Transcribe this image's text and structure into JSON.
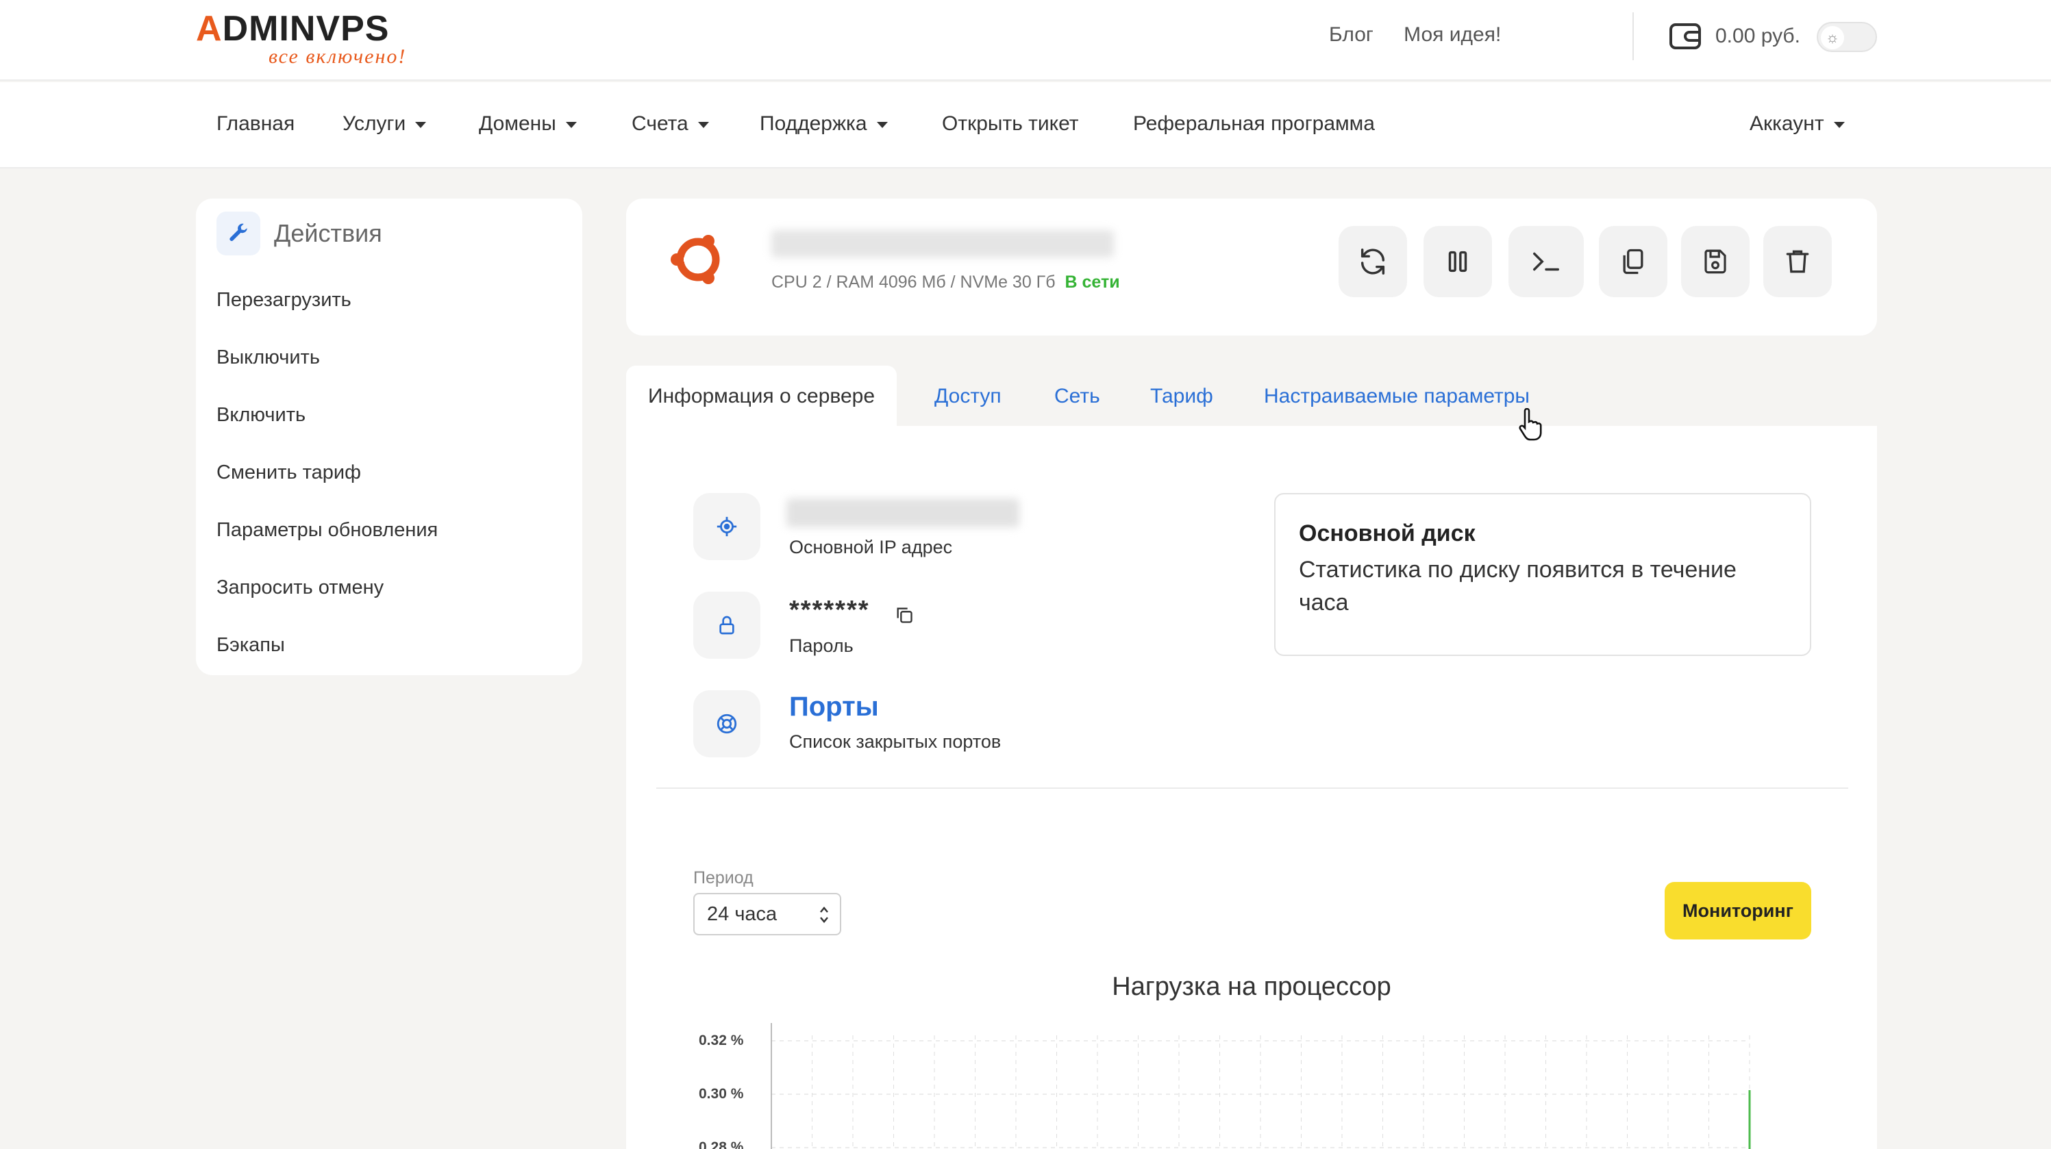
{
  "header": {
    "logo_brand_a": "A",
    "logo_brand_rest": "DMINVPS",
    "logo_slogan": "все включено!",
    "links": [
      "Блог",
      "Моя идея!"
    ],
    "balance": "0.00 руб.",
    "wallet_icon": "wallet-icon",
    "theme_icon": "sun-icon"
  },
  "nav": {
    "items": [
      {
        "label": "Главная",
        "dropdown": false
      },
      {
        "label": "Услуги",
        "dropdown": true
      },
      {
        "label": "Домены",
        "dropdown": true
      },
      {
        "label": "Счета",
        "dropdown": true
      },
      {
        "label": "Поддержка",
        "dropdown": true
      },
      {
        "label": "Открыть тикет",
        "dropdown": false
      },
      {
        "label": "Реферальная программа",
        "dropdown": false
      }
    ],
    "account": "Аккаунт"
  },
  "sidebar": {
    "title": "Действия",
    "icon": "wrench-icon",
    "items": [
      {
        "label": "Перезагрузить"
      },
      {
        "label": "Выключить"
      },
      {
        "label": "Включить"
      },
      {
        "label": "Сменить тариф"
      },
      {
        "label": "Параметры обновления"
      },
      {
        "label": "Запросить отмену"
      },
      {
        "label": "Бэкапы"
      }
    ]
  },
  "server": {
    "os_icon": "ubuntu-icon",
    "specs": "CPU 2 / RAM 4096 Мб / NVMe 30 Гб",
    "status": "В сети",
    "status_color": "#35b335",
    "actions": [
      "reload-icon",
      "pause-icon",
      "console-icon",
      "clone-icon",
      "save-icon",
      "trash-icon"
    ]
  },
  "tabs": [
    {
      "label": "Информация о сервере",
      "active": true
    },
    {
      "label": "Доступ",
      "active": false
    },
    {
      "label": "Сеть",
      "active": false
    },
    {
      "label": "Тариф",
      "active": false
    },
    {
      "label": "Настраиваемые параметры",
      "active": false
    }
  ],
  "info": {
    "ip_label": "Основной IP адрес",
    "password_value": "*******",
    "password_label": "Пароль",
    "ports_title": "Порты",
    "ports_label": "Список закрытых портов"
  },
  "disk": {
    "title": "Основной диск",
    "text": "Статистика по диску появится в течение часа"
  },
  "period": {
    "label": "Период",
    "value": "24 часа"
  },
  "monitoring_button": "Мониторинг",
  "chart_data": {
    "type": "line",
    "title": "Нагрузка на процессор",
    "ytick_labels": [
      "0.32 %",
      "0.30 %",
      "0.28 %"
    ],
    "grid": true
  },
  "colors": {
    "accent": "#2a6fd6",
    "brand": "#e85a1d",
    "monitor_button": "#f9dd2d"
  }
}
